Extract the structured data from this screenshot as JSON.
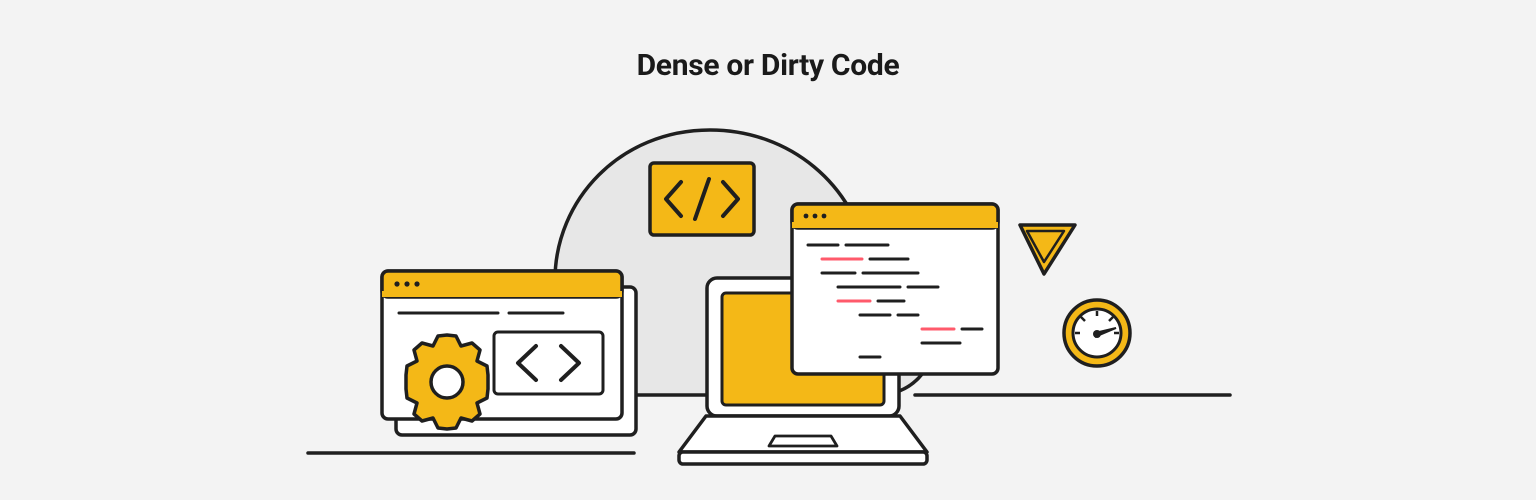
{
  "title": "Dense or Dirty Code",
  "colors": {
    "bg": "#f3f3f3",
    "yellow": "#f4b817",
    "stroke": "#1f1f1f",
    "cloud": "#e7e7e7",
    "highlight": "#ff5a6b",
    "white": "#ffffff"
  },
  "icons": {
    "cloud_back": "cloud-icon",
    "code_tag": "code-brackets-icon",
    "browser_window": "browser-window-icon",
    "gear": "gear-icon",
    "angle_brackets": "angle-brackets-icon",
    "laptop": "laptop-icon",
    "code_window": "code-window-icon",
    "cursor": "cursor-icon",
    "gauge": "gauge-icon"
  }
}
